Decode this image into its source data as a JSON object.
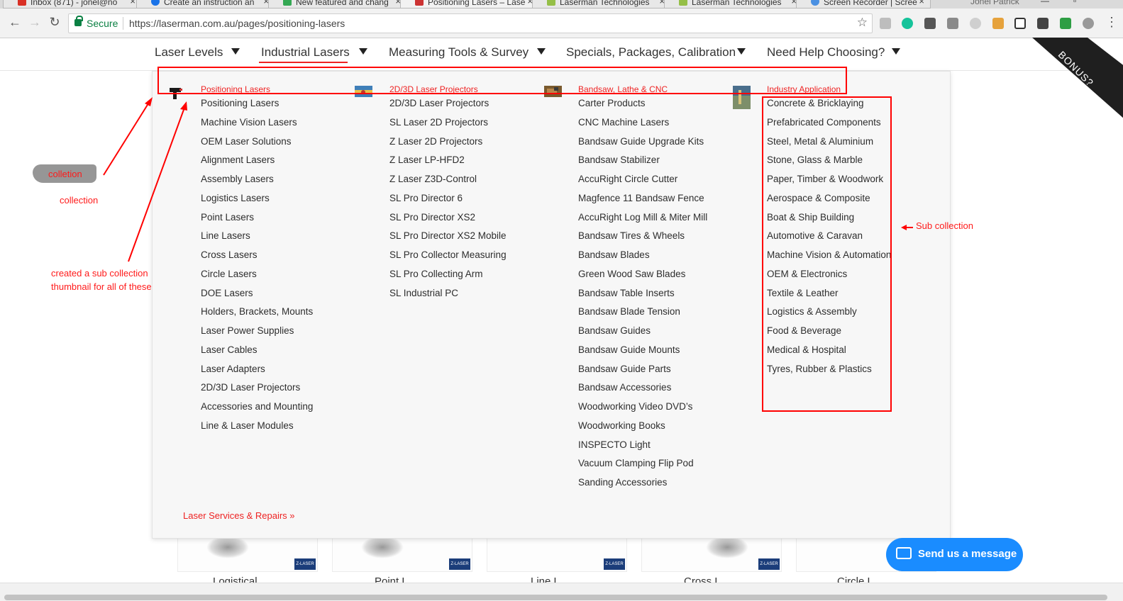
{
  "browser": {
    "tabs": [
      {
        "title": "Inbox (871) - jonel@no",
        "color": "#d93025"
      },
      {
        "title": "Create an instruction an",
        "color": "#1a73e8"
      },
      {
        "title": "New featured and chang",
        "color": "#34a853"
      },
      {
        "title": "Positioning Lasers – Lase",
        "color": "#c33"
      },
      {
        "title": "Laserman Technologies",
        "color": "#95bf47"
      },
      {
        "title": "Laserman Technologies",
        "color": "#95bf47"
      },
      {
        "title": "Screen Recorder | Scree",
        "color": "#4a90e2"
      }
    ],
    "profile_name": "Jonel Patrick",
    "secure_label": "Secure",
    "url": "https://laserman.com.au/pages/positioning-lasers"
  },
  "site_nav": {
    "items": [
      "Laser Levels",
      "Industrial Lasers",
      "Measuring Tools & Survey",
      "Specials, Packages, Calibration",
      "Need Help Choosing?"
    ],
    "bonus_label": "BONUS?"
  },
  "mega_menu": {
    "columns": [
      {
        "heading": "Positioning Lasers",
        "links": [
          "Positioning Lasers",
          "Machine Vision Lasers",
          "OEM Laser Solutions",
          "Alignment Lasers",
          "Assembly Lasers",
          "Logistics Lasers",
          "Point Lasers",
          "Line Lasers",
          "Cross Lasers",
          "Circle Lasers",
          "DOE Lasers",
          "Holders, Brackets, Mounts",
          "Laser Power Supplies",
          "Laser Cables",
          "Laser Adapters",
          "2D/3D Laser Projectors",
          "Accessories and Mounting",
          "Line & Laser Modules"
        ]
      },
      {
        "heading": "2D/3D Laser Projectors",
        "links": [
          "2D/3D Laser Projectors",
          "SL Laser 2D Projectors",
          "Z Laser 2D Projectors",
          "Z Laser LP-HFD2",
          "Z Laser Z3D-Control",
          "SL Pro Director 6",
          "SL Pro Director XS2",
          "SL Pro Director XS2 Mobile",
          "SL Pro Collector Measuring",
          "SL Pro Collecting Arm",
          "SL Industrial PC"
        ]
      },
      {
        "heading": "Bandsaw, Lathe & CNC",
        "links": [
          "Carter Products",
          "CNC Machine Lasers",
          "Bandsaw Guide Upgrade Kits",
          "Bandsaw Stabilizer",
          "AccuRight Circle Cutter",
          "Magfence 11 Bandsaw Fence",
          "AccuRight Log Mill & Miter Mill",
          "Bandsaw Tires & Wheels",
          "Bandsaw Blades",
          "Green Wood Saw Blades",
          "Bandsaw Table Inserts",
          "Bandsaw Blade Tension",
          "Bandsaw Guides",
          "Bandsaw Guide Mounts",
          "Bandsaw Guide Parts",
          "Bandsaw Accessories",
          "Woodworking Video DVD’s",
          "Woodworking Books",
          "INSPECTO Light",
          "Vacuum Clamping Flip Pod",
          "Sanding Accessories"
        ]
      },
      {
        "heading": "Industry Application",
        "links": [
          "Concrete & Bricklaying",
          "Prefabricated Components",
          "Steel, Metal & Aluminium",
          "Stone, Glass & Marble",
          "Paper, Timber & Woodwork",
          "Aerospace & Composite",
          "Boat & Ship Building",
          "Automotive & Caravan",
          "Machine Vision & Automation",
          "OEM & Electronics",
          "Textile & Leather",
          "Logistics & Assembly",
          "Food & Beverage",
          "Medical & Hospital",
          "Tyres, Rubber & Plastics"
        ]
      }
    ],
    "services_link": "Laser Services & Repairs »"
  },
  "annotations": {
    "scribbled_label": "colletion",
    "collection_label": "collection",
    "subcollection_note_line1": "created a sub collection",
    "subcollection_note_line2": "thumbnail for all of these",
    "sub_collection_label": "Sub collection"
  },
  "products": {
    "brand_badge": "Z-LASER",
    "names": [
      "Logistical",
      "Point L",
      "Line L",
      "Cross L",
      "Circle L"
    ]
  },
  "chat": {
    "label": "Send us a message"
  },
  "colors": {
    "accent_red": "#e22222",
    "chat_blue": "#1a8cff",
    "annotation_red": "#ff0000"
  }
}
